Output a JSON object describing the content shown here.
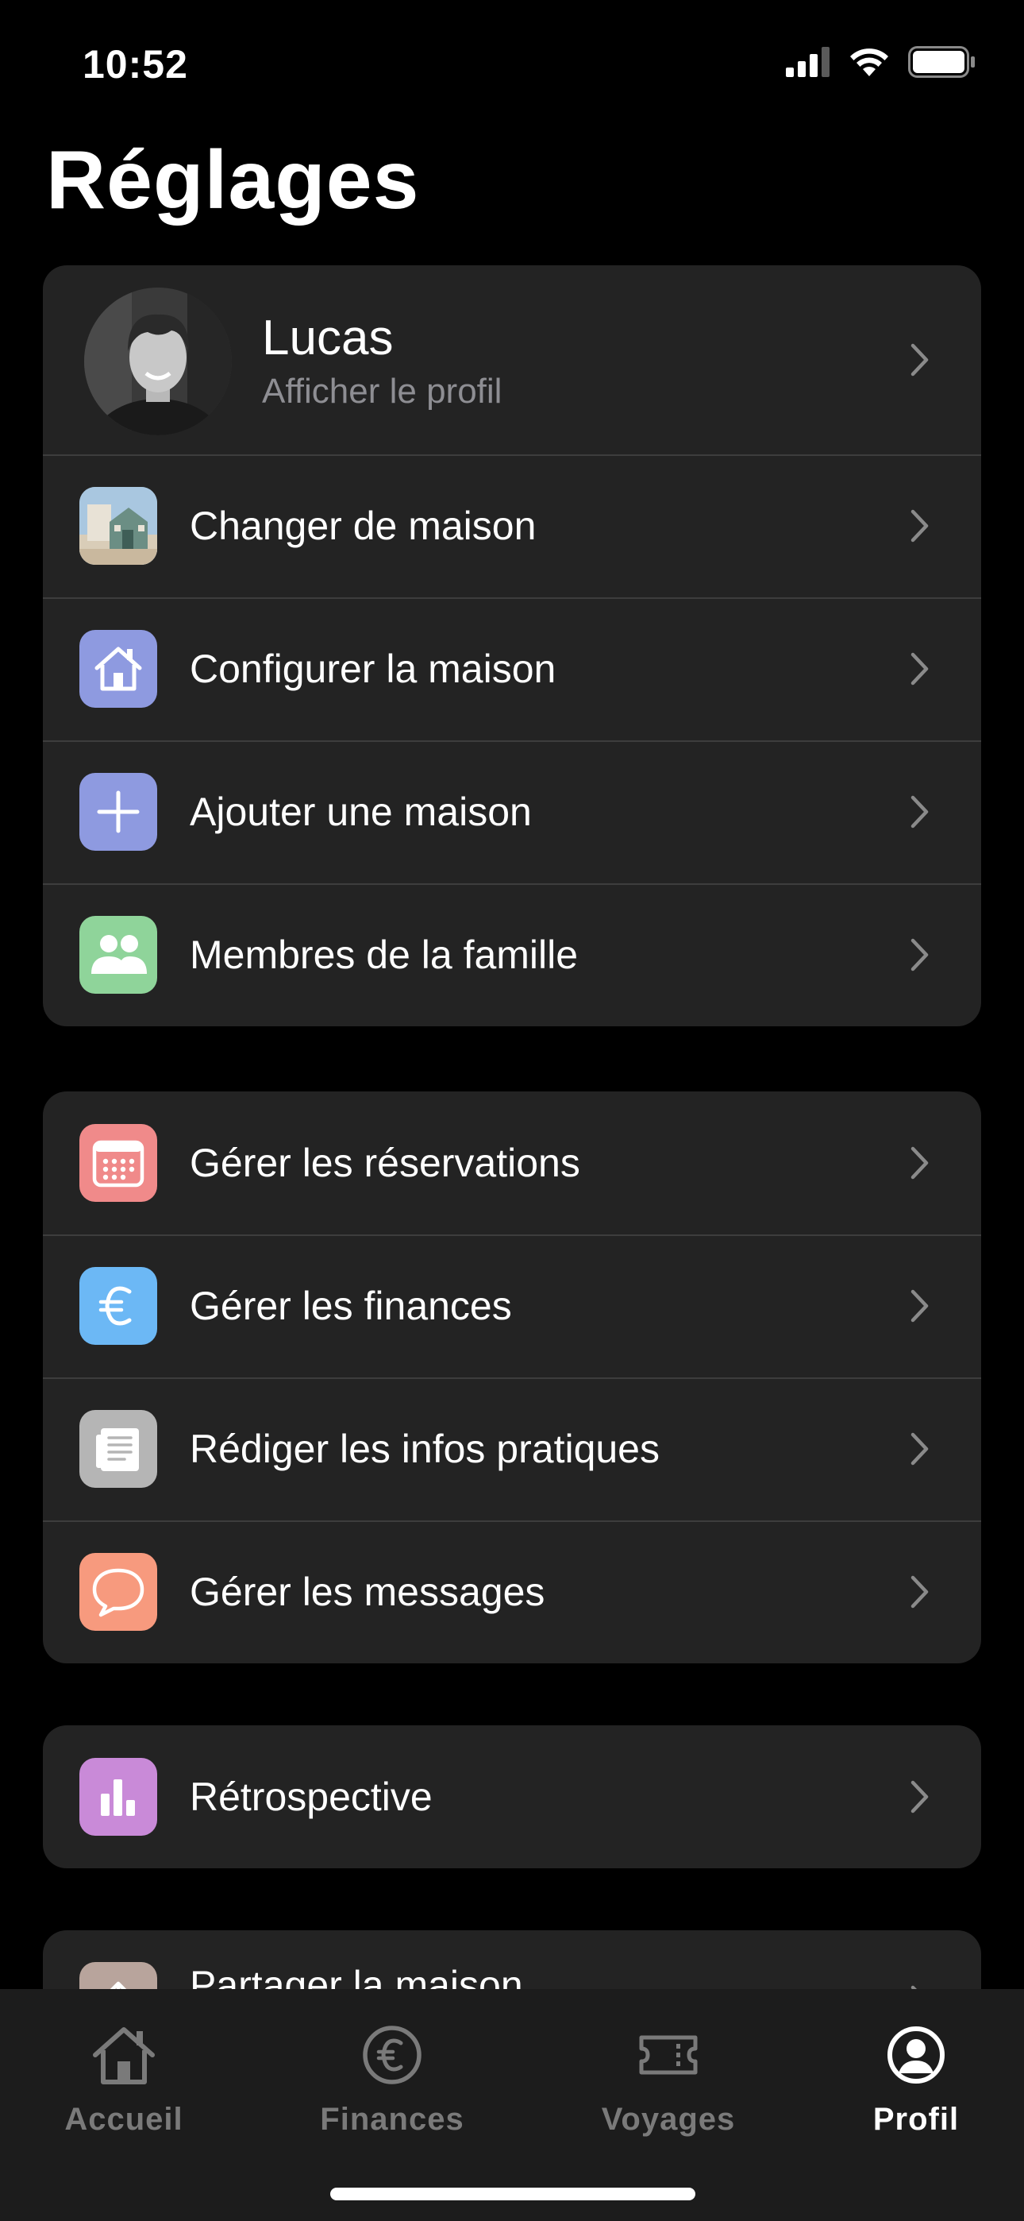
{
  "status_bar": {
    "time": "10:52"
  },
  "page": {
    "title": "Réglages"
  },
  "profile": {
    "name": "Lucas",
    "subtitle": "Afficher le profil"
  },
  "groups": {
    "home": [
      {
        "label": "Changer de maison",
        "icon": "house-photo-icon",
        "color": "#a9c7e0"
      },
      {
        "label": "Configurer la maison",
        "icon": "house-icon",
        "color": "#8e9ae0"
      },
      {
        "label": "Ajouter une maison",
        "icon": "plus-icon",
        "color": "#8e9ae0"
      },
      {
        "label": "Membres de la famille",
        "icon": "people-icon",
        "color": "#8fd49a"
      }
    ],
    "manage": [
      {
        "label": "Gérer les réservations",
        "icon": "calendar-icon",
        "color": "#f08a8a"
      },
      {
        "label": "Gérer les finances",
        "icon": "euro-icon",
        "color": "#6cb8f5"
      },
      {
        "label": "Rédiger les infos pratiques",
        "icon": "document-icon",
        "color": "#b5b5b5"
      },
      {
        "label": "Gérer les messages",
        "icon": "message-icon",
        "color": "#f79a7e"
      }
    ],
    "retro": [
      {
        "label": "Rétrospective",
        "icon": "chart-icon",
        "color": "#c98ad8"
      }
    ],
    "partial": [
      {
        "label": "Partager la maison",
        "icon": "share-icon",
        "color": "#b8a49c"
      }
    ]
  },
  "tab_bar": {
    "tabs": [
      {
        "label": "Accueil",
        "icon": "home-icon",
        "active": false
      },
      {
        "label": "Finances",
        "icon": "euro-circle-icon",
        "active": false
      },
      {
        "label": "Voyages",
        "icon": "ticket-icon",
        "active": false
      },
      {
        "label": "Profil",
        "icon": "profile-icon",
        "active": true
      }
    ]
  },
  "colors": {
    "background": "#000000",
    "card": "#232323",
    "separator": "#3d3d3d",
    "secondary_text": "#8e8e93",
    "tab_inactive": "#7a7a7a",
    "tab_active": "#ffffff"
  }
}
